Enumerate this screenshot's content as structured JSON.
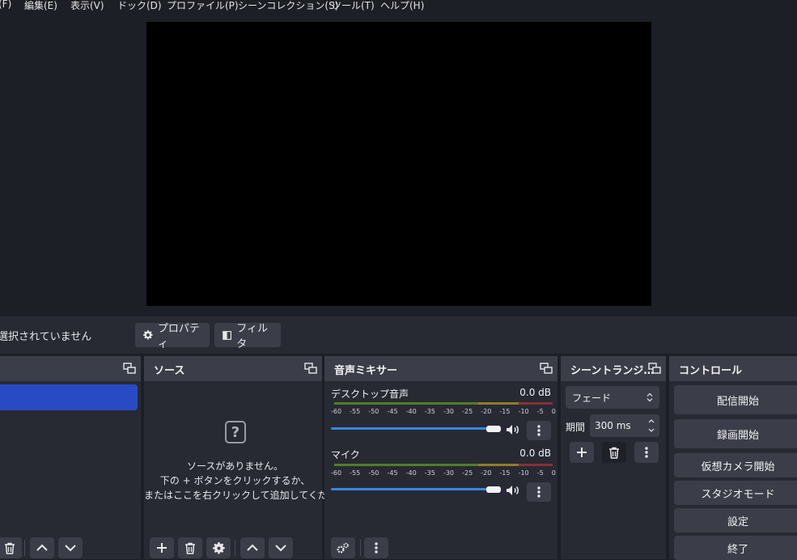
{
  "menubar": {
    "items": [
      "(F)",
      "編集(E)",
      "表示(V)",
      "ドック(D)",
      "プロファイル(P)",
      "シーンコレクション(S)",
      "ツール(T)",
      "ヘルプ(H)"
    ]
  },
  "context_bar": {
    "no_selection_text": "選択されていません",
    "properties_label": "プロパティ",
    "filters_label": "フィルタ"
  },
  "sources": {
    "title": "ソース",
    "empty_line1": "ソースがありません。",
    "empty_line2": "下の + ボタンをクリックするか、",
    "empty_line3": "またはここを右クリックして追加してください。"
  },
  "mixer": {
    "title": "音声ミキサー",
    "tick_labels": [
      "-60",
      "-55",
      "-50",
      "-45",
      "-40",
      "-35",
      "-30",
      "-25",
      "-20",
      "-15",
      "-10",
      "-5",
      "0"
    ],
    "channels": [
      {
        "name": "デスクトップ音声",
        "db": "0.0 dB",
        "volume_fraction": 1.0
      },
      {
        "name": "マイク",
        "db": "0.0 dB",
        "volume_fraction": 1.0
      }
    ]
  },
  "transitions": {
    "title": "シーントランジ…",
    "selected": "フェード",
    "duration_label": "期間",
    "duration_value": "300 ms"
  },
  "controls": {
    "title": "コントロール",
    "buttons": [
      "配信開始",
      "録画開始",
      "仮想カメラ開始",
      "スタジオモード",
      "設定",
      "終了"
    ]
  },
  "colors": {
    "accent": "#284bc4",
    "volume": "#3a86e0",
    "meter_green": "#4f7d2b",
    "meter_yellow": "#8f7d28",
    "meter_red": "#8a2f36"
  }
}
